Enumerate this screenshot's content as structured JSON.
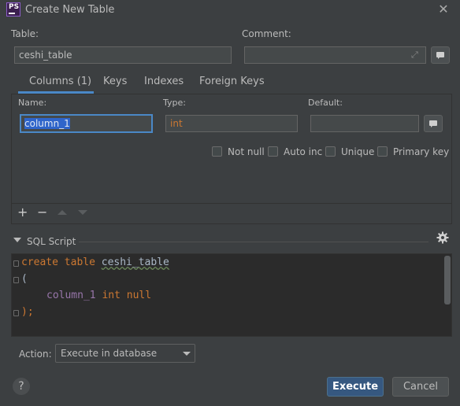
{
  "window": {
    "title": "Create New Table",
    "app_icon_text": "PS"
  },
  "table_label": "Table:",
  "table_value": "ceshi_table",
  "comment_label": "Comment:",
  "comment_value": "",
  "tabs": [
    {
      "label": "Columns (1)",
      "active": true
    },
    {
      "label": "Keys",
      "active": false
    },
    {
      "label": "Indexes",
      "active": false
    },
    {
      "label": "Foreign Keys",
      "active": false
    }
  ],
  "column": {
    "name_label": "Name:",
    "name_value": "column_1",
    "type_label": "Type:",
    "type_value": "int",
    "default_label": "Default:",
    "default_value": ""
  },
  "checkboxes": [
    {
      "label": "Not null",
      "checked": false
    },
    {
      "label": "Auto inc",
      "checked": false
    },
    {
      "label": "Unique",
      "checked": false
    },
    {
      "label": "Primary key",
      "checked": false
    }
  ],
  "toolbar": {
    "add": "+",
    "remove": "−"
  },
  "sql": {
    "title": "SQL Script",
    "line1_kw": "create table",
    "line1_id": "ceshi_table",
    "line2": "(",
    "line3_col": "column_1",
    "line3_kw": "int null",
    "line4": ");"
  },
  "action": {
    "label": "Action:",
    "value": "Execute in database"
  },
  "buttons": {
    "help": "?",
    "execute": "Execute",
    "cancel": "Cancel"
  },
  "colors": {
    "accent": "#4a88c7",
    "primary_button": "#365880",
    "background": "#3c3f41",
    "editor_bg": "#2b2b2b"
  }
}
